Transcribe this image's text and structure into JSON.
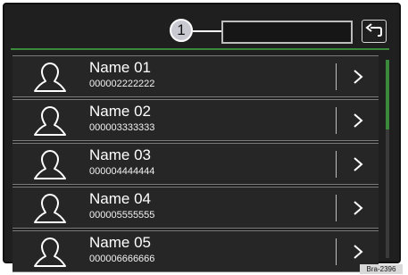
{
  "header": {
    "callout_number": "1",
    "title_field_value": "",
    "back_icon": "back-arrow-icon"
  },
  "contacts": [
    {
      "name": "Name 01",
      "number": "000002222222"
    },
    {
      "name": "Name 02",
      "number": "000003333333"
    },
    {
      "name": "Name 03",
      "number": "000004444444"
    },
    {
      "name": "Name 04",
      "number": "000005555555"
    },
    {
      "name": "Name 05",
      "number": "000006666666"
    }
  ],
  "icons": {
    "person": "person-icon",
    "chevron": "chevron-right-icon"
  },
  "scrollbar": {
    "position_fraction": 0.0,
    "visible_fraction": 0.35
  },
  "footer": {
    "image_ref": "Bra-2396"
  },
  "colors": {
    "accent": "#3b8a3b",
    "background": "#1f1f1f",
    "text": "#ffffff"
  }
}
